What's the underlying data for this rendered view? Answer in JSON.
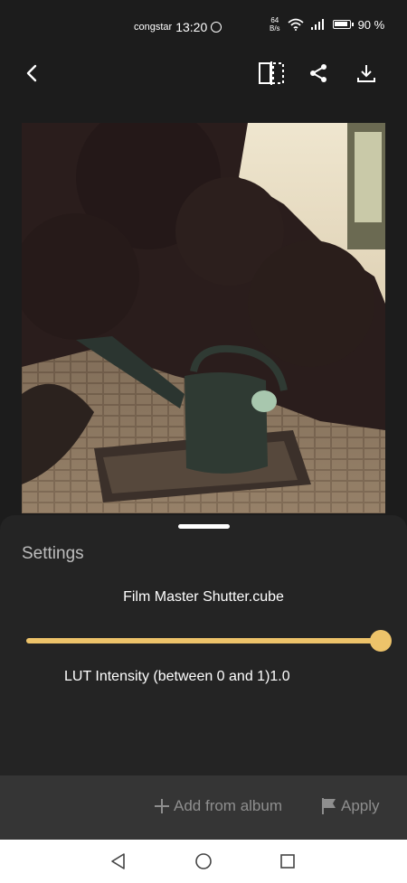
{
  "status_bar": {
    "carrier": "congstar",
    "time": "13:20",
    "net_speed_value": "64",
    "net_speed_unit": "B/s",
    "battery": "90 %"
  },
  "toolbar": {
    "icons": [
      "back-arrow-icon",
      "compare-icon",
      "share-icon",
      "download-icon"
    ]
  },
  "settings": {
    "title": "Settings",
    "lut_name": "Film Master Shutter.cube",
    "intensity_label": "LUT Intensity (between 0 and 1)1.0",
    "slider_value": 1.0,
    "accent_color": "#edc36a"
  },
  "bottom_bar": {
    "add_label": "Add from album",
    "apply_label": "Apply"
  },
  "nav_bar": {
    "icons": [
      "nav-back-icon",
      "nav-home-icon",
      "nav-recents-icon"
    ]
  }
}
